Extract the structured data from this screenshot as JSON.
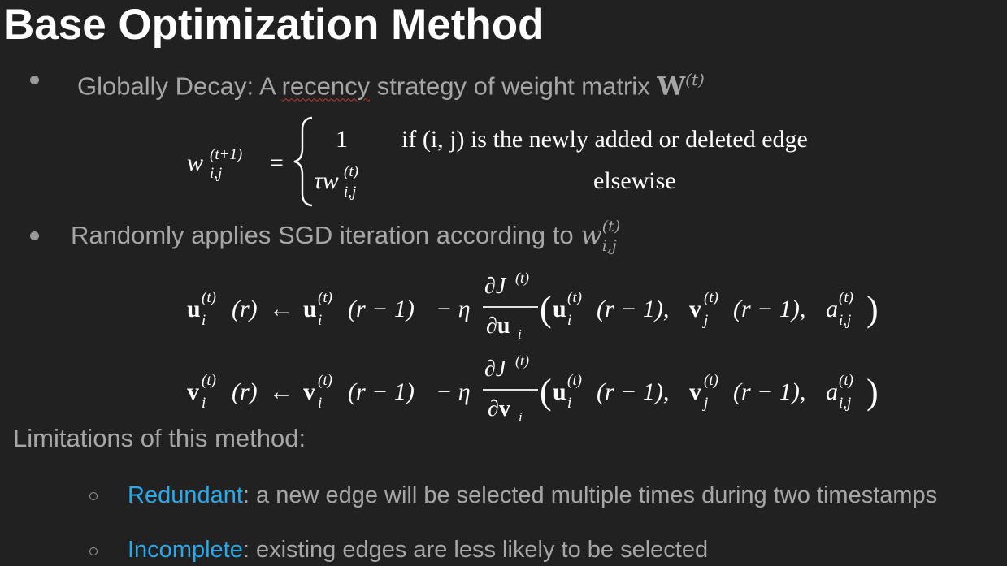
{
  "slide": {
    "title": "Base Optimization Method",
    "bullets": [
      {
        "prefix": "Globally Decay: A ",
        "squiggle_word": "recency",
        "suffix": " strategy of weight matrix ",
        "math_tail": "W",
        "math_sup": "(t)"
      },
      {
        "prefix": "Randomly applies SGD iteration according to ",
        "math_var": "w",
        "math_sub": "i,j",
        "math_sup": "(t)"
      }
    ],
    "equation_weight": {
      "lhs": "w",
      "lhs_sub": "i,j",
      "lhs_sup": "(t+1)",
      "eq": "=",
      "case1_value": "1",
      "case1_condition": "if (i, j) is the newly added or deleted edge",
      "case2_value": "τw",
      "case2_sub": "i,j",
      "case2_sup": "(t)",
      "case2_condition": "elsewise"
    },
    "equation_u": {
      "lhs": "u",
      "sub_i": "i",
      "sup_t": "(t)",
      "r": "(r)",
      "arrow": "←",
      "r_minus_1": "(r − 1)",
      "minus_eta": "− η",
      "numerator": "∂J",
      "denominator": "∂u",
      "args": "(u, v, a)"
    },
    "equation_v": {
      "lhs": "v",
      "denominator": "∂v"
    },
    "limitations_heading": "Limitations of this method:",
    "limitations": [
      {
        "keyword": "Redundant",
        "text": ": a new edge will be selected multiple times during two timestamps"
      },
      {
        "keyword": "Incomplete",
        "text": ": existing edges are less likely to be selected"
      }
    ]
  },
  "colors": {
    "background": "#212121",
    "title": "#ffffff",
    "body_text": "#a6a6a6",
    "accent": "#2aa8e8",
    "math": "#ffffff"
  }
}
